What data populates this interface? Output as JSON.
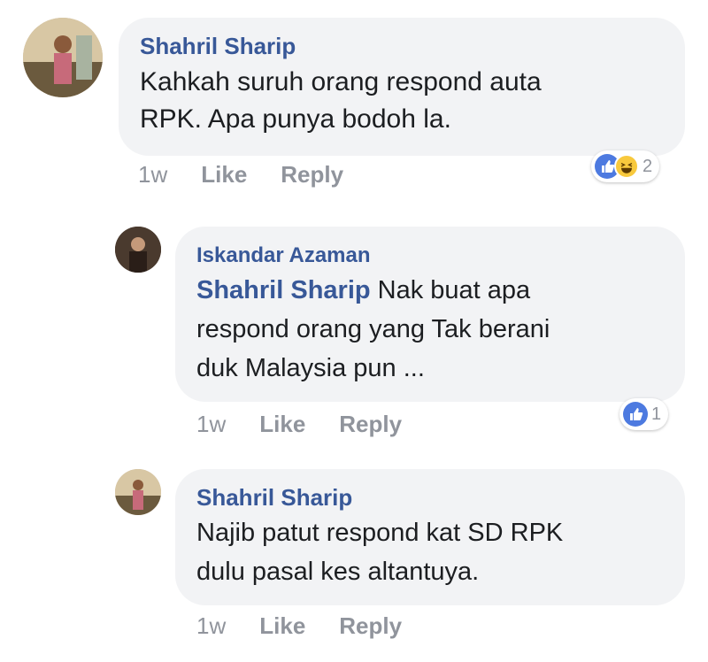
{
  "comments": [
    {
      "author": "Shahril Sharip",
      "text": "Kahkah suruh orang respond auta\nRPK. Apa punya bodoh la.",
      "time": "1w",
      "like": "Like",
      "reply": "Reply",
      "reaction_count": "2",
      "reactions": [
        "like-icon",
        "haha-icon"
      ]
    },
    {
      "author": "Iskandar Azaman",
      "mention": "Shahril Sharip",
      "text": " Nak buat apa\nrespond orang yang Tak berani\nduk Malaysia pun ...",
      "time": "1w",
      "like": "Like",
      "reply": "Reply",
      "reaction_count": "1",
      "reactions": [
        "like-icon"
      ]
    },
    {
      "author": "Shahril Sharip",
      "text": "Najib patut respond kat SD RPK\ndulu pasal kes altantuya.",
      "time": "1w",
      "like": "Like",
      "reply": "Reply"
    }
  ],
  "colors": {
    "link": "#385898",
    "bubble": "#f2f3f5",
    "like": "#4d7ae0",
    "haha": "#f8c93d",
    "meta": "#90949c"
  }
}
